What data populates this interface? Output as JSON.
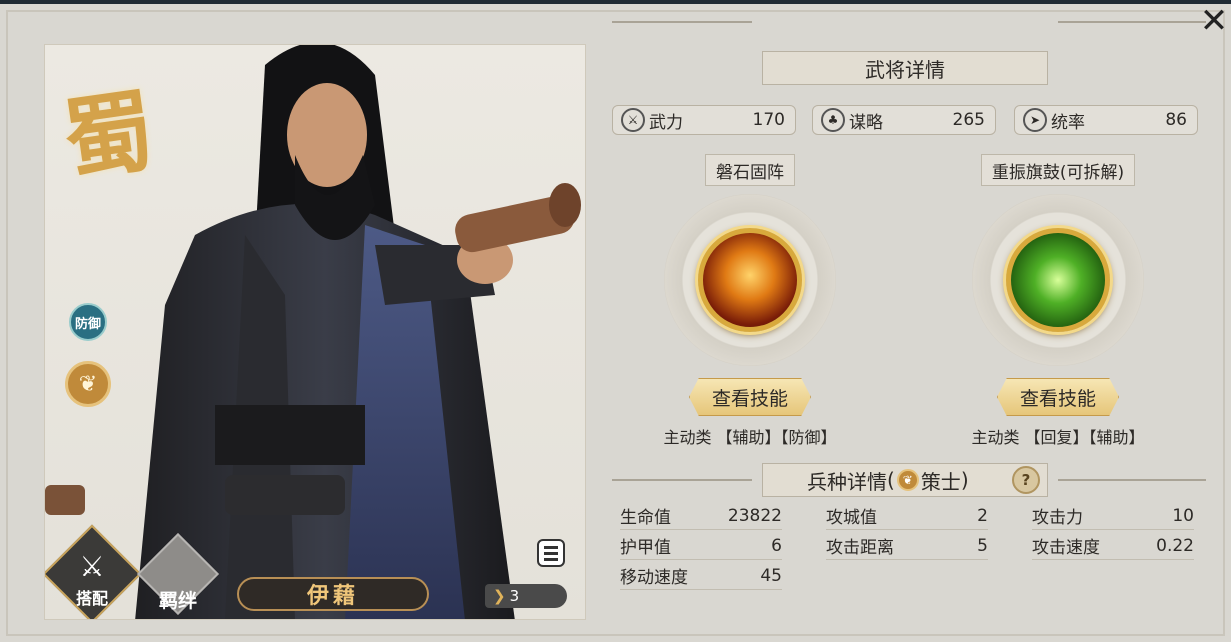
{
  "hero": {
    "kingdom_glyph": "蜀",
    "name": "伊藉",
    "rank_value": "3",
    "role_badge": "防御",
    "troop_badge_glyph": "❦"
  },
  "left_buttons": {
    "equip_label": "搭配",
    "bond_label": "羁绊"
  },
  "general_details": {
    "title": "武将详情",
    "stats": [
      {
        "label": "武力",
        "value": "170",
        "icon": "force-icon"
      },
      {
        "label": "谋略",
        "value": "265",
        "icon": "strategy-icon"
      },
      {
        "label": "统率",
        "value": "86",
        "icon": "command-icon"
      }
    ]
  },
  "skills": [
    {
      "name": "磐石固阵",
      "button": "查看技能",
      "type": "主动类 【辅助】【防御】",
      "color": "#e07a14"
    },
    {
      "name": "重振旗鼓(可拆解)",
      "button": "查看技能",
      "type": "主动类 【回复】【辅助】",
      "color": "#4fb026"
    }
  ],
  "troop_details": {
    "title_prefix": "兵种详情",
    "open_paren": "(",
    "troop_type": "策士",
    "close_paren": ")",
    "help": "?",
    "stats": [
      {
        "label": "生命值",
        "value": "23822"
      },
      {
        "label": "攻城值",
        "value": "2"
      },
      {
        "label": "攻击力",
        "value": "10"
      },
      {
        "label": "护甲值",
        "value": "6"
      },
      {
        "label": "攻击距离",
        "value": "5"
      },
      {
        "label": "攻击速度",
        "value": "0.22"
      },
      {
        "label": "移动速度",
        "value": "45"
      }
    ]
  },
  "close_glyph": "✕"
}
